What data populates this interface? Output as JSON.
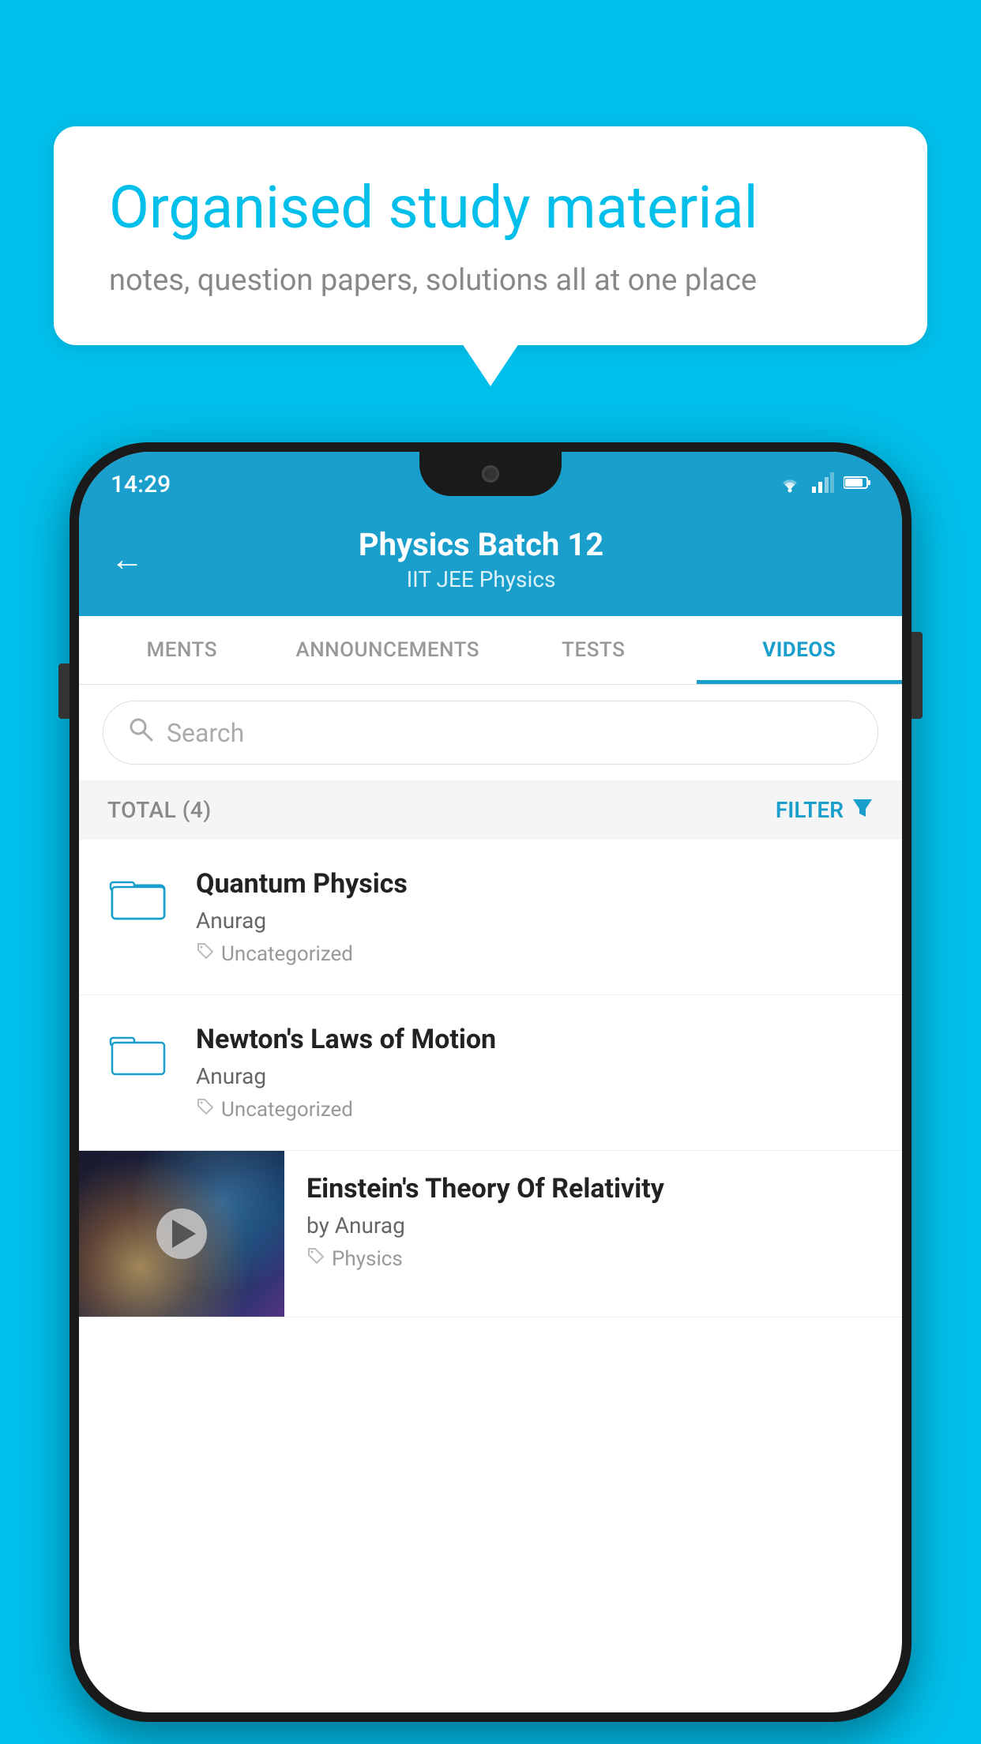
{
  "background": {
    "color": "#00BFEA"
  },
  "speech_bubble": {
    "title": "Organised study material",
    "subtitle": "notes, question papers, solutions all at one place"
  },
  "phone": {
    "status_bar": {
      "time": "14:29",
      "wifi_icon": "▾▾",
      "signal_icon": "▲",
      "battery_icon": "▮"
    },
    "header": {
      "back_label": "←",
      "title": "Physics Batch 12",
      "subtitle": "IIT JEE    Physics"
    },
    "tabs": [
      {
        "label": "MENTS",
        "active": false
      },
      {
        "label": "ANNOUNCEMENTS",
        "active": false
      },
      {
        "label": "TESTS",
        "active": false
      },
      {
        "label": "VIDEOS",
        "active": true
      }
    ],
    "search": {
      "placeholder": "Search"
    },
    "filter_bar": {
      "total": "TOTAL (4)",
      "filter_label": "FILTER"
    },
    "videos": [
      {
        "id": 1,
        "title": "Quantum Physics",
        "author": "Anurag",
        "tag": "Uncategorized",
        "has_thumbnail": false
      },
      {
        "id": 2,
        "title": "Newton's Laws of Motion",
        "author": "Anurag",
        "tag": "Uncategorized",
        "has_thumbnail": false
      },
      {
        "id": 3,
        "title": "Einstein's Theory Of Relativity",
        "author": "by Anurag",
        "tag": "Physics",
        "has_thumbnail": true
      }
    ]
  }
}
